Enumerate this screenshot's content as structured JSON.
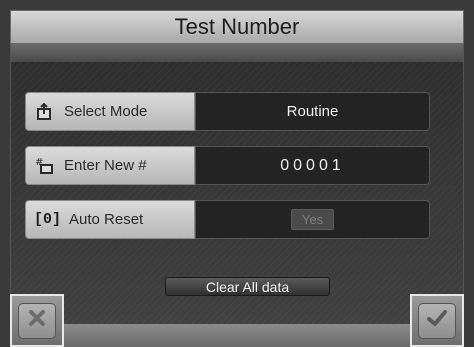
{
  "title": "Test Number",
  "rows": [
    {
      "label": "Select Mode",
      "icon": "select-mode-icon",
      "value": "Routine"
    },
    {
      "label": "Enter New #",
      "icon": "hash-edit-icon",
      "value": "00001"
    },
    {
      "label": "Auto Reset",
      "prefix": "[0]",
      "value": "Yes"
    }
  ],
  "clear_button": "Clear All data",
  "colors": {
    "panel": "#2d2d2d",
    "label_bg": "#d0d0d0",
    "value_bg": "#232323"
  }
}
